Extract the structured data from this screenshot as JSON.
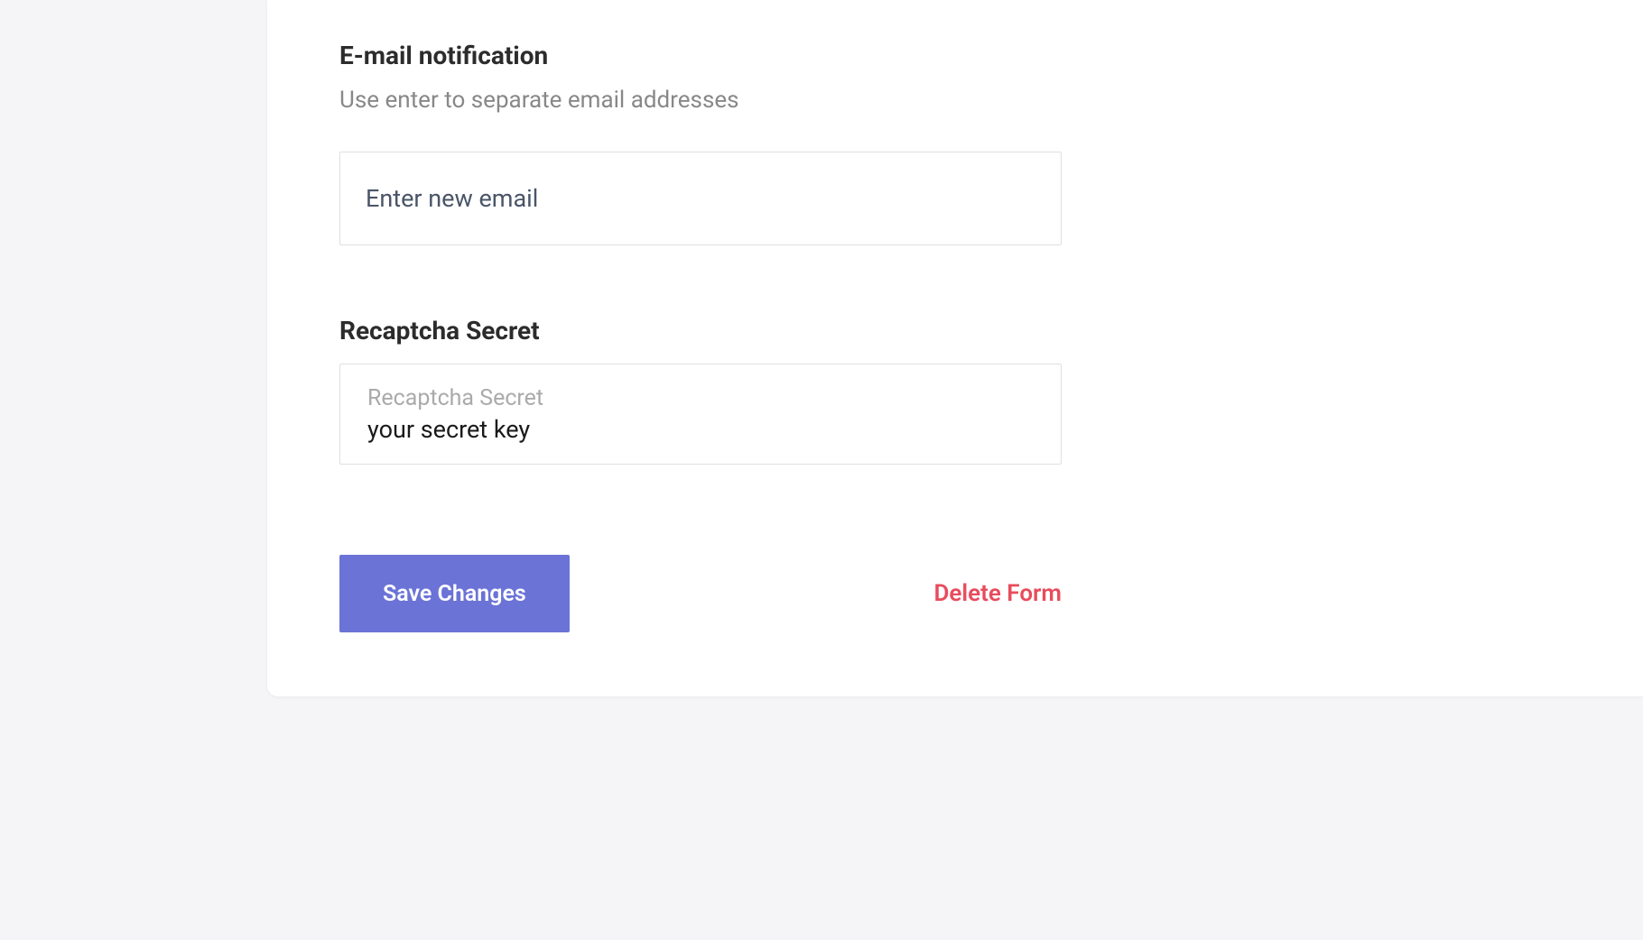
{
  "emailSection": {
    "title": "E-mail notification",
    "description": "Use enter to separate email addresses",
    "placeholder": "Enter new email",
    "value": ""
  },
  "recaptchaSection": {
    "title": "Recaptcha Secret",
    "floatingLabel": "Recaptcha Secret",
    "value": "your secret key"
  },
  "actions": {
    "saveLabel": "Save Changes",
    "deleteLabel": "Delete Form"
  }
}
